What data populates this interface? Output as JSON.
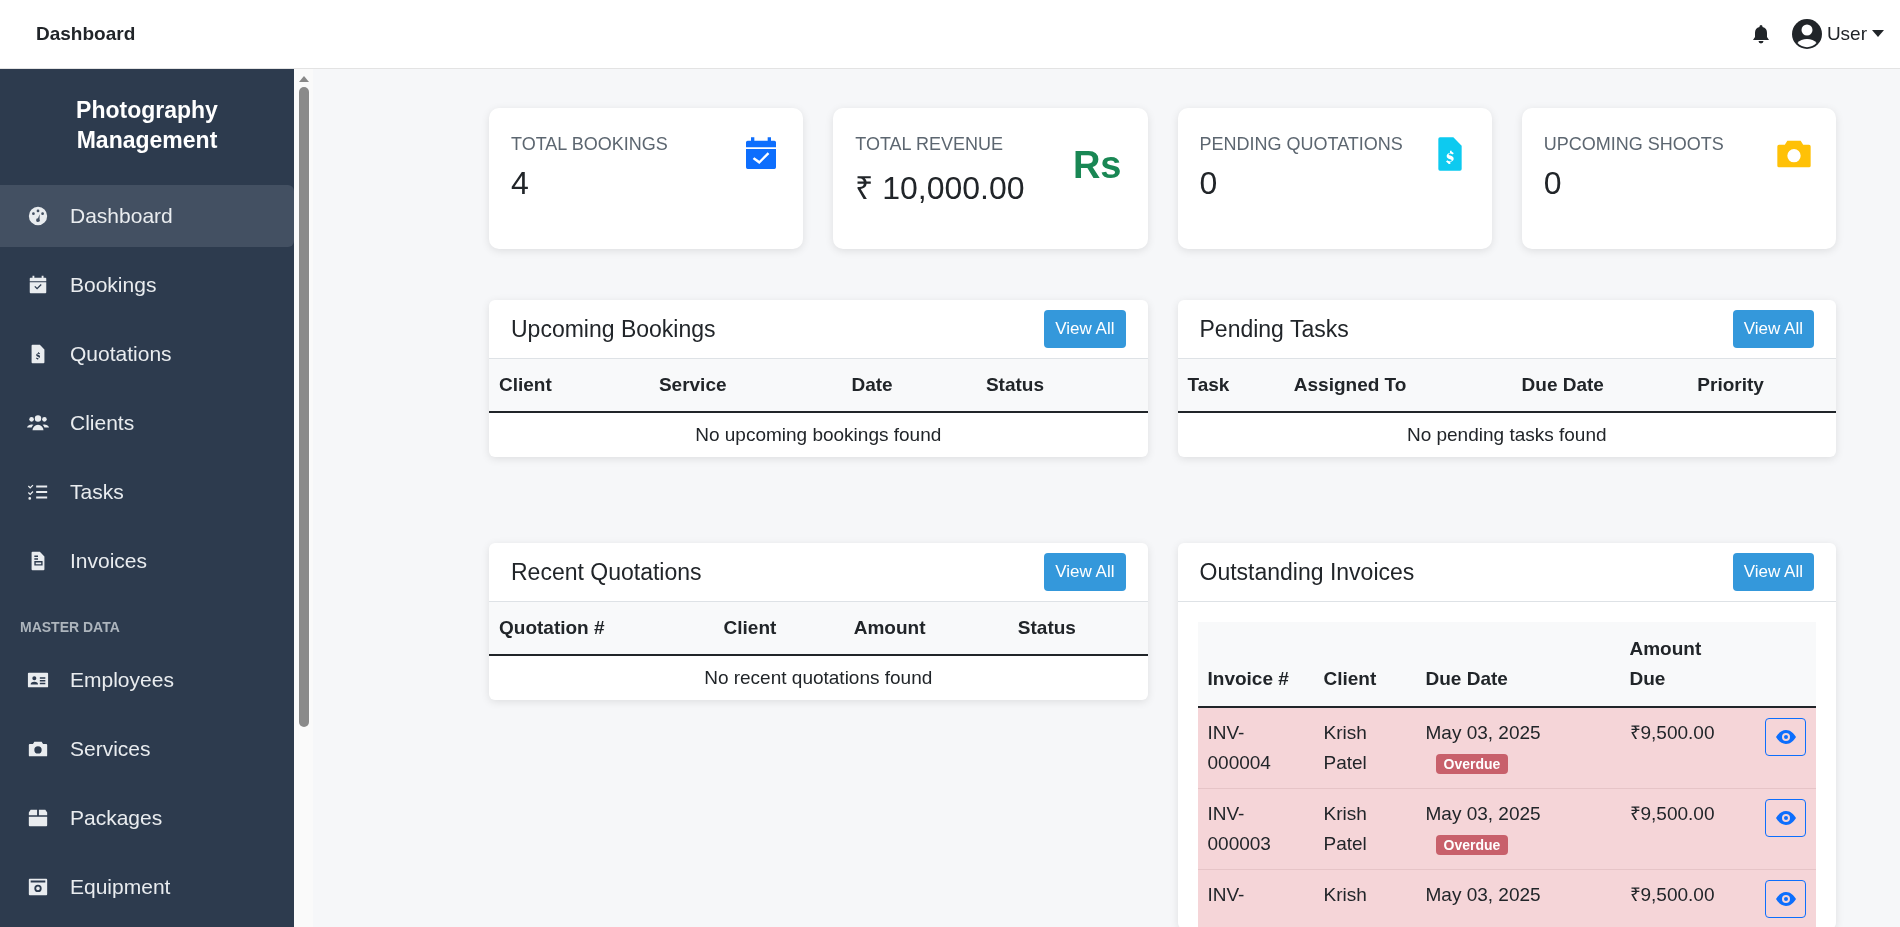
{
  "topbar": {
    "title": "Dashboard",
    "user": "User"
  },
  "sidebar": {
    "title": "Photography Management",
    "items": [
      {
        "label": "Dashboard",
        "selected": true
      },
      {
        "label": "Bookings",
        "selected": false
      },
      {
        "label": "Quotations",
        "selected": false
      },
      {
        "label": "Clients",
        "selected": false
      },
      {
        "label": "Tasks",
        "selected": false
      },
      {
        "label": "Invoices",
        "selected": false
      }
    ],
    "section": "MASTER DATA",
    "master_items": [
      {
        "label": "Employees",
        "selected": false
      },
      {
        "label": "Services",
        "selected": false
      },
      {
        "label": "Packages",
        "selected": false
      },
      {
        "label": "Equipment",
        "selected": false
      }
    ]
  },
  "stats": [
    {
      "label": "TOTAL BOOKINGS",
      "value": "4",
      "color": "#0d6efd"
    },
    {
      "label": "TOTAL REVENUE",
      "value": "₹ 10,000.00",
      "symbol": "Rs",
      "color": "#198754"
    },
    {
      "label": "PENDING QUOTATIONS",
      "value": "0",
      "color": "#0dcaf0"
    },
    {
      "label": "UPCOMING SHOOTS",
      "value": "0",
      "color": "#ffc107"
    }
  ],
  "panels": [
    {
      "title": "Upcoming Bookings",
      "button": "View All",
      "columns": [
        "Client",
        "Service",
        "Date",
        "Status"
      ],
      "empty": "No upcoming bookings found"
    },
    {
      "title": "Pending Tasks",
      "button": "View All",
      "columns": [
        "Task",
        "Assigned To",
        "Due Date",
        "Priority"
      ],
      "empty": "No pending tasks found"
    },
    {
      "title": "Recent Quotations",
      "button": "View All",
      "columns": [
        "Quotation #",
        "Client",
        "Amount",
        "Status"
      ],
      "empty": "No recent quotations found"
    }
  ],
  "outstanding_invoices": {
    "title": "Outstanding Invoices",
    "button": "View All",
    "columns": [
      "Invoice #",
      "Client",
      "Due Date",
      "Amount Due"
    ],
    "rows": [
      {
        "invoice": "INV-000004",
        "client": "Krish Patel",
        "due_date": "May 03, 2025",
        "badge": "Overdue",
        "amount": "₹9,500.00"
      },
      {
        "invoice": "INV-000003",
        "client": "Krish Patel",
        "due_date": "May 03, 2025",
        "badge": "Overdue",
        "amount": "₹9,500.00"
      },
      {
        "invoice": "INV-",
        "client": "Krish",
        "due_date": "May 03, 2025",
        "amount": "₹9,500.00"
      }
    ]
  }
}
